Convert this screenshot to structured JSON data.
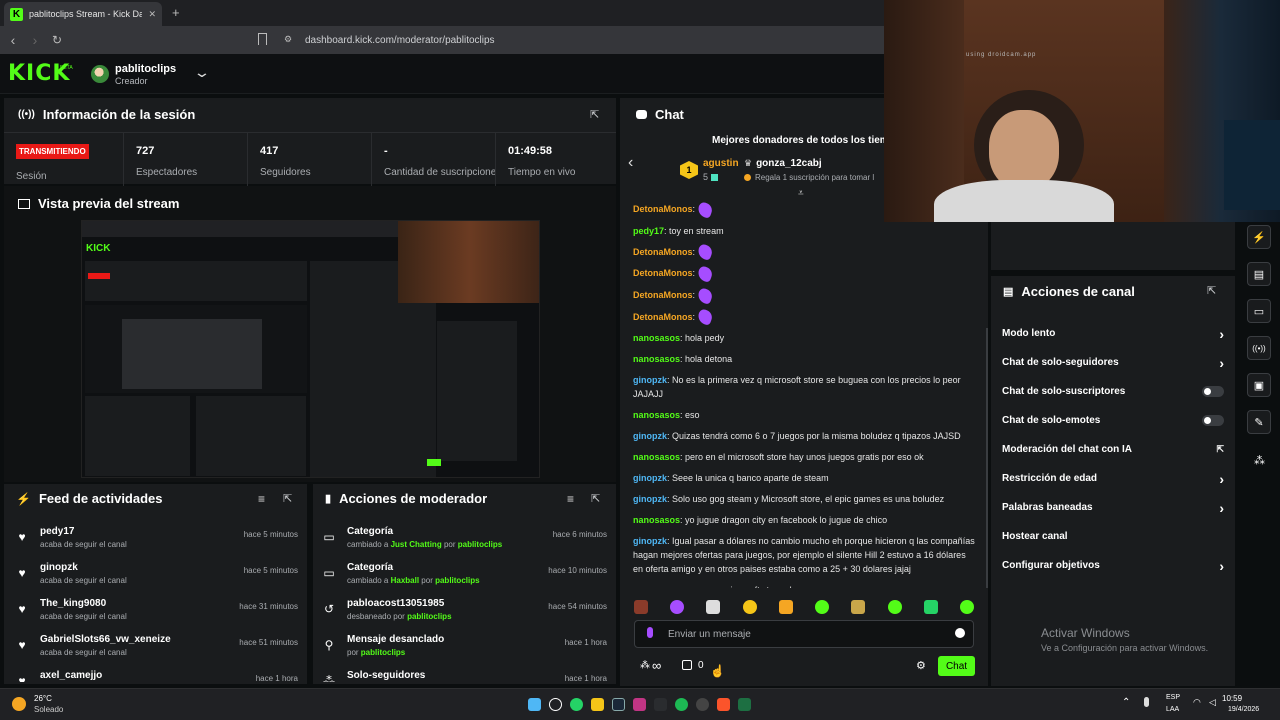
{
  "browser": {
    "tab_title": "pablitoclips Stream - Kick Dashb",
    "url": "dashboard.kick.com/moderator/pablitoclips"
  },
  "header": {
    "logo": "KICK",
    "beta": "BETA",
    "username": "pablitoclips",
    "role": "Creador"
  },
  "session": {
    "title": "Información de la sesión",
    "status": "TRANSMITIENDO",
    "status_label": "Sesión",
    "stats": [
      {
        "value": "727",
        "label": "Espectadores"
      },
      {
        "value": "417",
        "label": "Seguidores"
      },
      {
        "value": "-",
        "label": "Cantidad de suscripciones"
      },
      {
        "value": "01:49:58",
        "label": "Tiempo en vivo"
      }
    ]
  },
  "preview": {
    "title": "Vista previa del stream"
  },
  "feed": {
    "title": "Feed de actividades",
    "items": [
      {
        "user": "pedy17",
        "text": "acaba de seguir el canal",
        "time": "hace 5 minutos"
      },
      {
        "user": "ginopzk",
        "text": "acaba de seguir el canal",
        "time": "hace 5 minutos"
      },
      {
        "user": "The_king9080",
        "text": "acaba de seguir el canal",
        "time": "hace 31 minutos"
      },
      {
        "user": "GabrielSlots66_vw_xeneize",
        "text": "acaba de seguir el canal",
        "time": "hace 51 minutos"
      },
      {
        "user": "axel_camejjo",
        "text": "",
        "time": "hace 1 hora"
      }
    ]
  },
  "modactions": {
    "title": "Acciones de moderador",
    "items": [
      {
        "title": "Categoría",
        "pre": "cambiado a",
        "target": "Just Chatting",
        "mid": "por",
        "by": "pablitoclips",
        "time": "hace 6 minutos",
        "icon": "category-icon"
      },
      {
        "title": "Categoría",
        "pre": "cambiado a",
        "target": "Haxball",
        "mid": "por",
        "by": "pablitoclips",
        "time": "hace 10 minutos",
        "icon": "category-icon"
      },
      {
        "title": "pabloacost13051985",
        "pre": "desbaneado por",
        "target": "pablitoclips",
        "mid": "",
        "by": "",
        "time": "hace 54 minutos",
        "icon": "unban-icon"
      },
      {
        "title": "Mensaje desanclado",
        "pre": "por",
        "target": "pablitoclips",
        "mid": "",
        "by": "",
        "time": "hace 1 hora",
        "icon": "unpin-icon"
      },
      {
        "title": "Solo-seguidores",
        "pre": "",
        "target": "",
        "mid": "",
        "by": "",
        "time": "hace 1 hora",
        "icon": "followers-icon"
      }
    ]
  },
  "chat": {
    "title": "Chat",
    "donors_title": "Mejores donadores de todos los tiemp",
    "donor1": {
      "rank": "1",
      "name": "agustin",
      "count": "5"
    },
    "donor2": {
      "name": "gonza_12cabj",
      "text": "Regala 1 suscripción para tomar l"
    },
    "messages": [
      {
        "user": "DetonaMonos",
        "color": "o",
        "text": "",
        "emote": true
      },
      {
        "user": "pedy17",
        "color": "g",
        "text": "toy en stream",
        "emote": false
      },
      {
        "user": "DetonaMonos",
        "color": "o",
        "text": "",
        "emote": true
      },
      {
        "user": "DetonaMonos",
        "color": "o",
        "text": "",
        "emote": true
      },
      {
        "user": "DetonaMonos",
        "color": "o",
        "text": "",
        "emote": true
      },
      {
        "user": "DetonaMonos",
        "color": "o",
        "text": "",
        "emote": true
      },
      {
        "user": "nanosasos",
        "color": "g",
        "text": "hola pedy",
        "emote": false
      },
      {
        "user": "nanosasos",
        "color": "g",
        "text": "hola detona",
        "emote": false
      },
      {
        "user": "ginopzk",
        "color": "b",
        "text": "No es la primera vez q microsoft store se buguea con los precios lo peor JAJAJJ",
        "emote": false
      },
      {
        "user": "nanosasos",
        "color": "g",
        "text": "eso",
        "emote": false
      },
      {
        "user": "ginopzk",
        "color": "b",
        "text": "Quizas tendrá como 6 o 7 juegos por la misma boludez q tipazos JAJSD",
        "emote": false
      },
      {
        "user": "nanosasos",
        "color": "g",
        "text": "pero en el microsoft store hay unos juegos gratis por eso ok",
        "emote": false
      },
      {
        "user": "ginopzk",
        "color": "b",
        "text": "Seee la unica q banco aparte de steam",
        "emote": false
      },
      {
        "user": "ginopzk",
        "color": "b",
        "text": "Solo uso gog steam y Microsoft store, el epic games es una boludez",
        "emote": false
      },
      {
        "user": "nanosasos",
        "color": "g",
        "text": "yo jugue dragon city en facebook lo jugue de chico",
        "emote": false
      },
      {
        "user": "ginopzk",
        "color": "b",
        "text": "Igual pasar a dólares no cambio mucho eh porque hicieron q las compañías hagan mejores ofertas para juegos, por ejemplo el silente Hill 2 estuvo a 16 dólares en oferta amigo y en otros paises estaba como a 25 + 30 dolares jajaj",
        "emote": false
      },
      {
        "user": "nanosasos",
        "color": "g",
        "text": "vos usas microsoft store okey",
        "emote": false
      }
    ],
    "input_placeholder": "Enviar un mensaje",
    "infinity": "∞",
    "points": "0",
    "send_label": "Chat"
  },
  "channel_actions": {
    "title": "Acciones de canal",
    "items": [
      {
        "label": "Modo lento",
        "control": "chevron"
      },
      {
        "label": "Chat de solo-seguidores",
        "control": "chevron"
      },
      {
        "label": "Chat de solo-suscriptores",
        "control": "toggle"
      },
      {
        "label": "Chat de solo-emotes",
        "control": "toggle"
      },
      {
        "label": "Moderación del chat con IA",
        "control": "external"
      },
      {
        "label": "Restricción de edad",
        "control": "chevron"
      },
      {
        "label": "Palabras baneadas",
        "control": "chevron"
      },
      {
        "label": "Hostear canal",
        "control": "none"
      },
      {
        "label": "Configurar objetivos",
        "control": "chevron"
      }
    ]
  },
  "windows_watermark": {
    "title": "Activar Windows",
    "subtitle": "Ve a Configuración para activar Windows."
  },
  "webcam": {
    "watermark": "using droidcam.app"
  },
  "taskbar": {
    "weather_temp": "26°C",
    "weather_desc": "Soleado",
    "lang1": "ESP",
    "lang2": "LAA",
    "time": "10:59",
    "date": "19/4/2026"
  },
  "colors": {
    "accent": "#53fc18",
    "live": "#e91916",
    "panel": "#1a1c1e",
    "bg": "#0b0e0f"
  }
}
